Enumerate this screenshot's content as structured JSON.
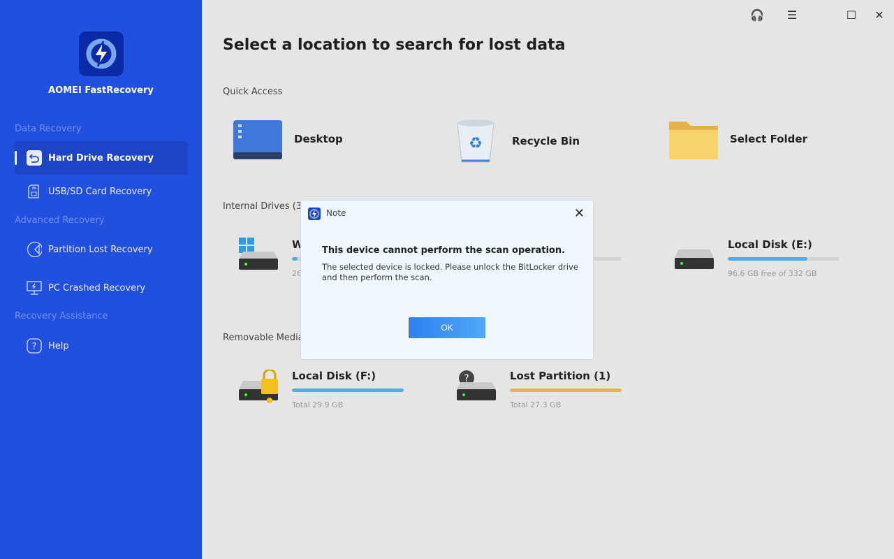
{
  "app": {
    "name": "AOMEI FastRecovery"
  },
  "sidebar": {
    "sections": [
      {
        "title": "Data Recovery",
        "items": [
          {
            "label": "Hard Drive Recovery",
            "icon": "undo-icon",
            "active": true
          },
          {
            "label": "USB/SD Card Recovery",
            "icon": "sd-card-icon"
          }
        ]
      },
      {
        "title": "Advanced Recovery",
        "items": [
          {
            "label": "Partition Lost Recovery",
            "icon": "partition-icon"
          },
          {
            "label": "PC Crashed Recovery",
            "icon": "monitor-bolt-icon"
          }
        ]
      },
      {
        "title": "Recovery Assistance",
        "items": [
          {
            "label": "Help",
            "icon": "question-icon"
          }
        ]
      }
    ]
  },
  "main": {
    "title": "Select a location to search for lost data",
    "quick_access": {
      "label": "Quick Access",
      "items": [
        {
          "label": "Desktop"
        },
        {
          "label": "Recycle Bin"
        },
        {
          "label": "Select Folder"
        }
      ]
    },
    "internal": {
      "label": "Internal Drives (3)",
      "drives": [
        {
          "name": "W",
          "size": "26",
          "fill": 0.05
        },
        {
          "name": "Local Disk (E:)",
          "size": "96.6 GB free of 332 GB",
          "fill": 0.71
        }
      ]
    },
    "removable": {
      "label": "Removable Media",
      "drives": [
        {
          "name": "Local Disk (F:)",
          "size": "Total 29.9 GB",
          "fill": 1,
          "color": "#4fb0e0",
          "locked": true
        },
        {
          "name": "Lost Partition (1)",
          "size": "Total 27.3 GB",
          "fill": 1,
          "color": "#e2b84a"
        }
      ]
    }
  },
  "dialog": {
    "title": "Note",
    "heading": "This device cannot perform the scan operation.",
    "body": "The selected device is locked. Please unlock the BitLocker drive and then perform the scan.",
    "ok": "OK"
  },
  "colors": {
    "sidebar": "#2150de",
    "accent": "#2f7ff0",
    "bar_blue": "#4fb0e0",
    "bar_yellow": "#e2b84a"
  }
}
